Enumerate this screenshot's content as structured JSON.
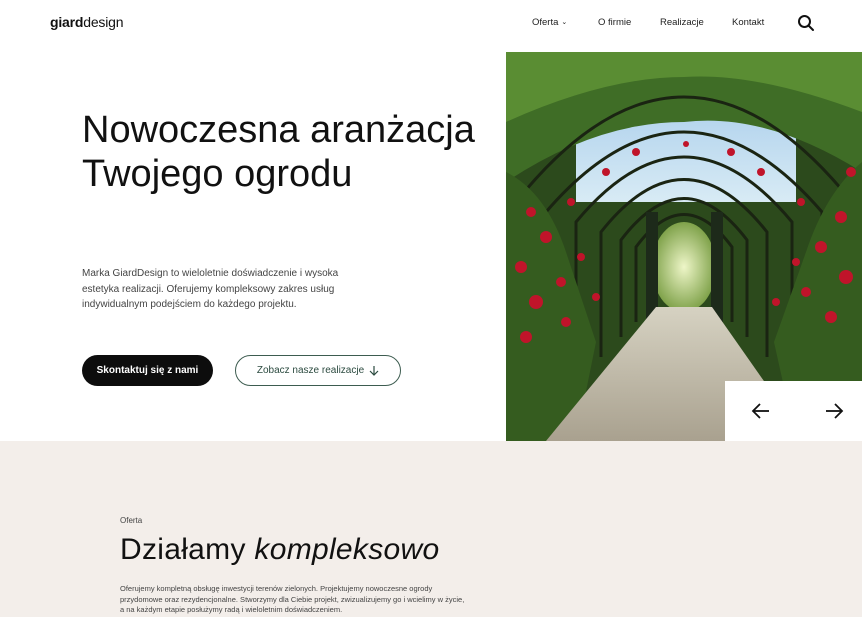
{
  "header": {
    "logo_bold": "giard",
    "logo_light": "design",
    "nav": [
      "Oferta",
      "O firmie",
      "Realizacje",
      "Kontakt"
    ]
  },
  "hero": {
    "title": "Nowoczesna aranżacja Twojego ogrodu",
    "description": "Marka GiardDesign to wieloletnie doświadczenie i wysoka estetyka realizacji. Oferujemy kompleksowy zakres usług indywidualnym podejściem do każdego projektu.",
    "primary_button": "Skontaktuj się z nami",
    "secondary_button": "Zobacz nasze realizacje"
  },
  "offer": {
    "label": "Oferta",
    "title_regular": "Działamy",
    "title_italic": "kompleksowo",
    "text": "Oferujemy kompletną obsługę inwestycji terenów zielonych. Projektujemy nowoczesne ogrody przydomowe oraz rezydencjonalne. Stworzymy dla Ciebie projekt, zwizualizujemy go i wcielimy w życie, a na każdym etapie posłużymy radą i wieloletnim doświadczeniem."
  },
  "colors": {
    "primary": "#0d0d0d",
    "outline_green": "#3d5c50",
    "offer_bg": "#f3eeea"
  },
  "icons": [
    "chevron-down-icon",
    "search-icon",
    "arrow-left-icon",
    "arrow-right-icon",
    "arrow-down-icon"
  ]
}
